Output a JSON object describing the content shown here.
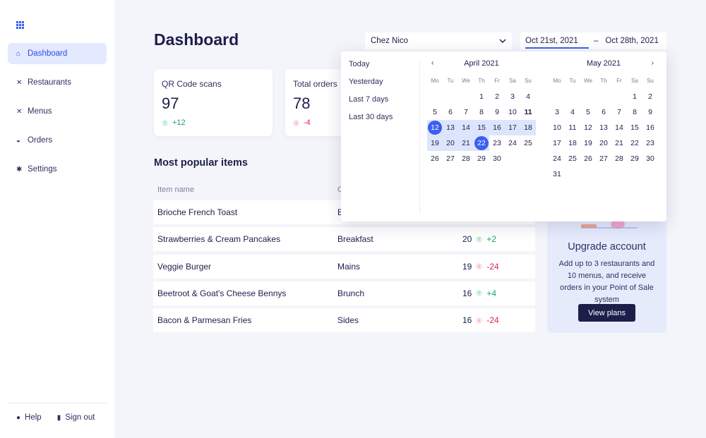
{
  "sidebar": {
    "items": [
      {
        "label": "Dashboard",
        "icon": "home-icon",
        "active": true
      },
      {
        "label": "Restaurants",
        "icon": "utensils-icon"
      },
      {
        "label": "Menus",
        "icon": "utensils-icon"
      },
      {
        "label": "Orders",
        "icon": "basket-icon"
      },
      {
        "label": "Settings",
        "icon": "tools-icon"
      }
    ],
    "help": "Help",
    "signout": "Sign out"
  },
  "header": {
    "title": "Dashboard",
    "restaurant": "Chez Nico",
    "date_start": "Oct 21st, 2021",
    "date_sep": "–",
    "date_end": "Oct 28th, 2021"
  },
  "stats": [
    {
      "label": "QR Code scans",
      "value": "97",
      "delta": "+12",
      "trend": "up"
    },
    {
      "label": "Total orders",
      "value": "78",
      "delta": "-4",
      "trend": "down"
    }
  ],
  "popular": {
    "title": "Most popular items",
    "col_name": "Item name",
    "col_category": "C",
    "rows": [
      {
        "name": "Brioche French Toast",
        "category": "B",
        "count": "",
        "delta": "",
        "trend": ""
      },
      {
        "name": "Strawberries & Cream Pancakes",
        "category": "Breakfast",
        "count": "20",
        "delta": "+2",
        "trend": "up"
      },
      {
        "name": "Veggie Burger",
        "category": "Mains",
        "count": "19",
        "delta": "-24",
        "trend": "down"
      },
      {
        "name": "Beetroot & Goat's Cheese Bennys",
        "category": "Brunch",
        "count": "16",
        "delta": "+4",
        "trend": "up"
      },
      {
        "name": "Bacon & Parmesan Fries",
        "category": "Sides",
        "count": "16",
        "delta": "-24",
        "trend": "down"
      }
    ]
  },
  "upgrade": {
    "title": "Upgrade account",
    "text": "Add up to 3 restaurants and 10 menus, and receive orders in your Point of Sale system",
    "button": "View plans"
  },
  "datepicker": {
    "presets": [
      "Today",
      "Yesterday",
      "Last 7 days",
      "Last 30 days"
    ],
    "prev_icon": "‹",
    "next_icon": "›",
    "weekdays": [
      "Mo",
      "Tu",
      "We",
      "Th",
      "Fr",
      "Sa",
      "Su"
    ],
    "months": [
      {
        "name": "April 2021",
        "offset": 3,
        "days": 30,
        "range_start": 12,
        "range_end": 22,
        "selected": [
          12,
          22
        ],
        "bold": [
          11
        ]
      },
      {
        "name": "May 2021",
        "offset": 5,
        "days": 31,
        "range_start": 0,
        "range_end": 0,
        "selected": [],
        "bold": []
      }
    ]
  },
  "colors": {
    "accent": "#3b5ff0",
    "up": "#1aa066",
    "down": "#e0245e",
    "navy": "#1c1f4a"
  }
}
